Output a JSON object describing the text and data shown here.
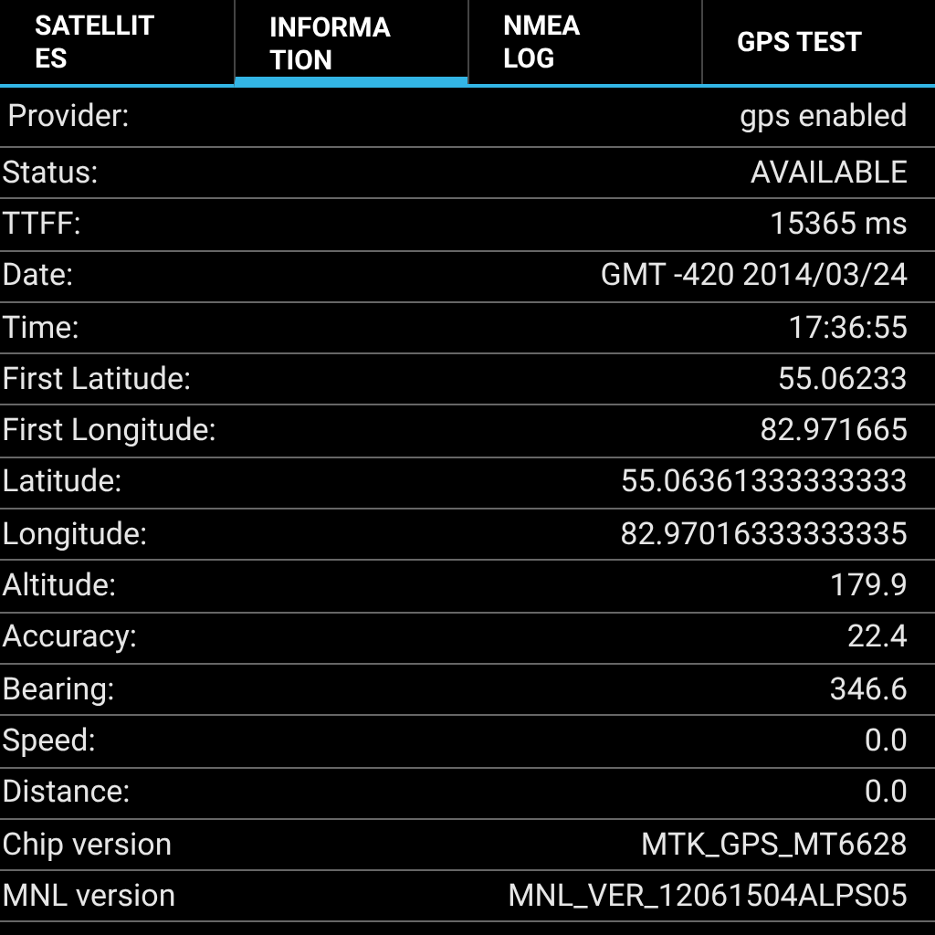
{
  "tabs": [
    {
      "label_lines": [
        "SATELLIT",
        "ES"
      ],
      "selected": false
    },
    {
      "label_lines": [
        "INFORMA",
        "TION"
      ],
      "selected": true
    },
    {
      "label_lines": [
        "NMEA",
        "LOG"
      ],
      "selected": false
    },
    {
      "label_lines": [
        "GPS TEST"
      ],
      "selected": false
    }
  ],
  "rows": [
    {
      "label": "Provider:",
      "value": "gps enabled"
    },
    {
      "label": "Status:",
      "value": "AVAILABLE"
    },
    {
      "label": "TTFF:",
      "value": "15365 ms"
    },
    {
      "label": "Date:",
      "value": "GMT -420 2014/03/24"
    },
    {
      "label": "Time:",
      "value": "17:36:55"
    },
    {
      "label": "First Latitude:",
      "value": "55.06233"
    },
    {
      "label": "First Longitude:",
      "value": "82.971665"
    },
    {
      "label": "Latitude:",
      "value": "55.06361333333333"
    },
    {
      "label": "Longitude:",
      "value": "82.97016333333335"
    },
    {
      "label": "Altitude:",
      "value": "179.9"
    },
    {
      "label": "Accuracy:",
      "value": "22.4"
    },
    {
      "label": "Bearing:",
      "value": "346.6"
    },
    {
      "label": "Speed:",
      "value": "0.0"
    },
    {
      "label": "Distance:",
      "value": "0.0"
    },
    {
      "label": "Chip version",
      "value": "MTK_GPS_MT6628"
    },
    {
      "label": "MNL version",
      "value": "MNL_VER_12061504ALPS05"
    }
  ]
}
